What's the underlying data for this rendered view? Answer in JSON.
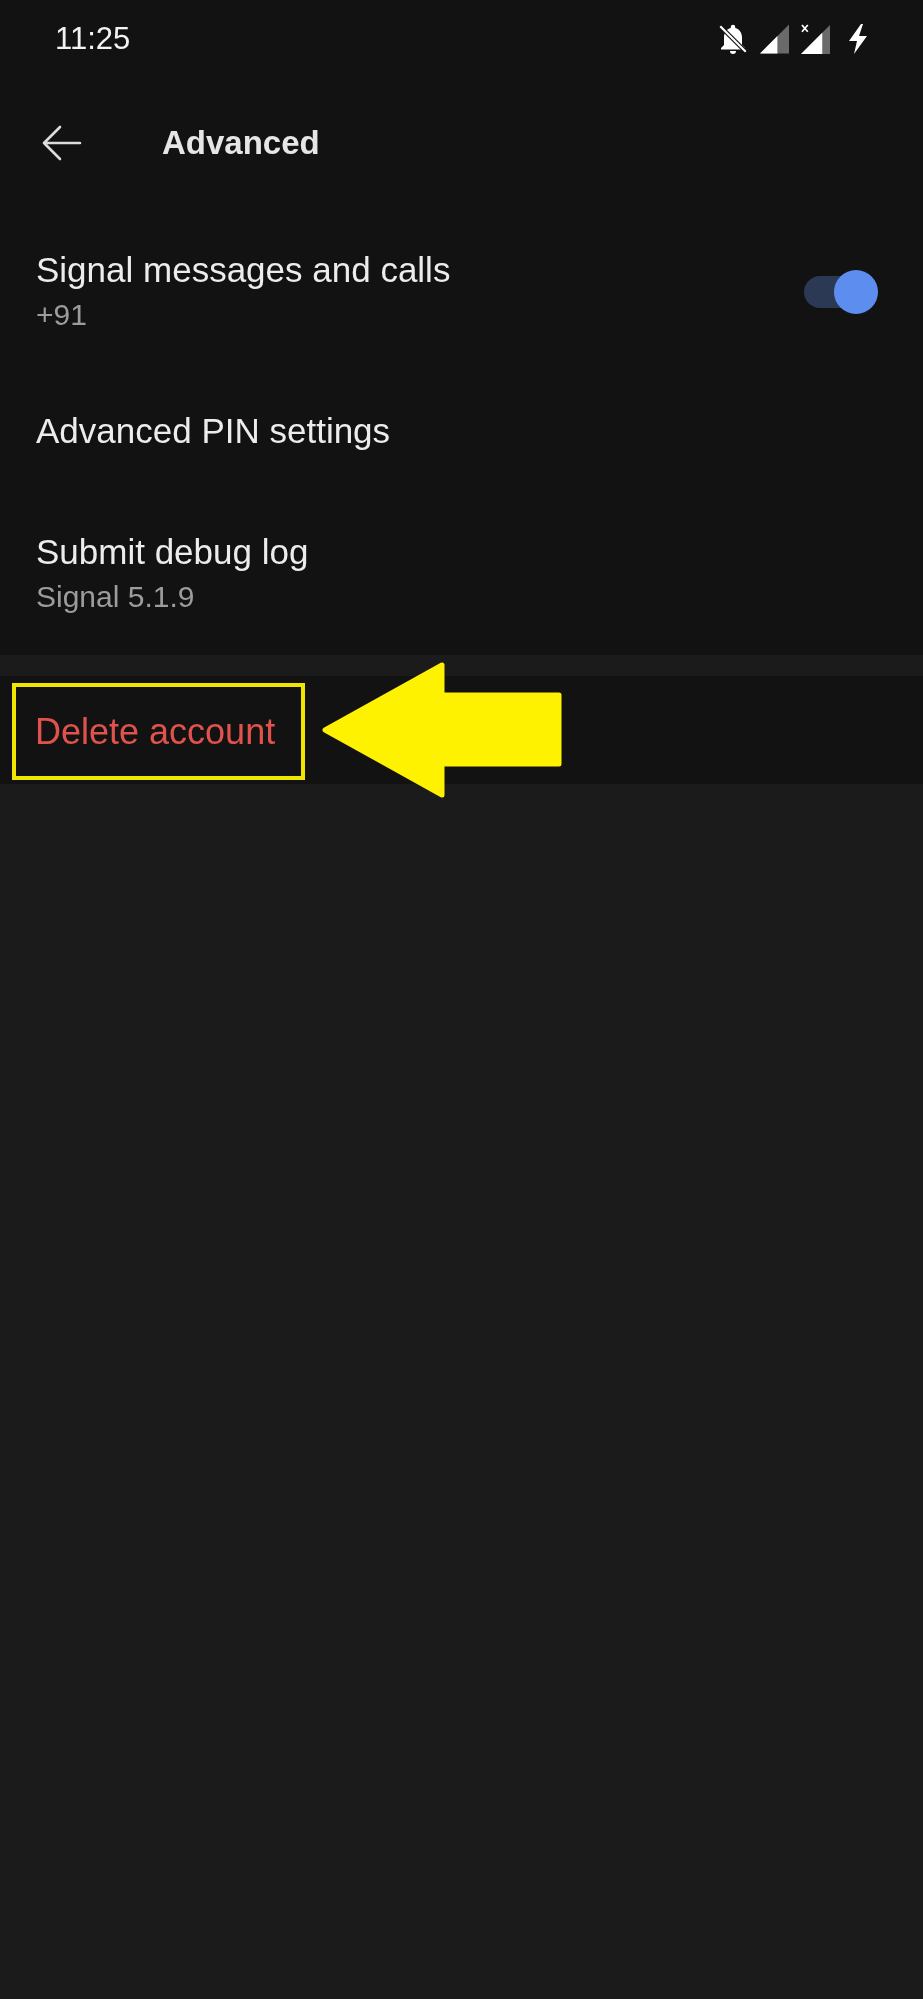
{
  "status_bar": {
    "time": "11:25"
  },
  "toolbar": {
    "title": "Advanced"
  },
  "settings": [
    {
      "kind": "toggle",
      "title": "Signal messages and calls",
      "subtitle": "+91",
      "on": true
    },
    {
      "kind": "plain",
      "title": "Advanced PIN settings"
    },
    {
      "kind": "plain",
      "title": "Submit debug log",
      "subtitle": "Signal 5.1.9"
    }
  ],
  "danger_zone": {
    "label": "Delete account",
    "highlighted": true
  }
}
